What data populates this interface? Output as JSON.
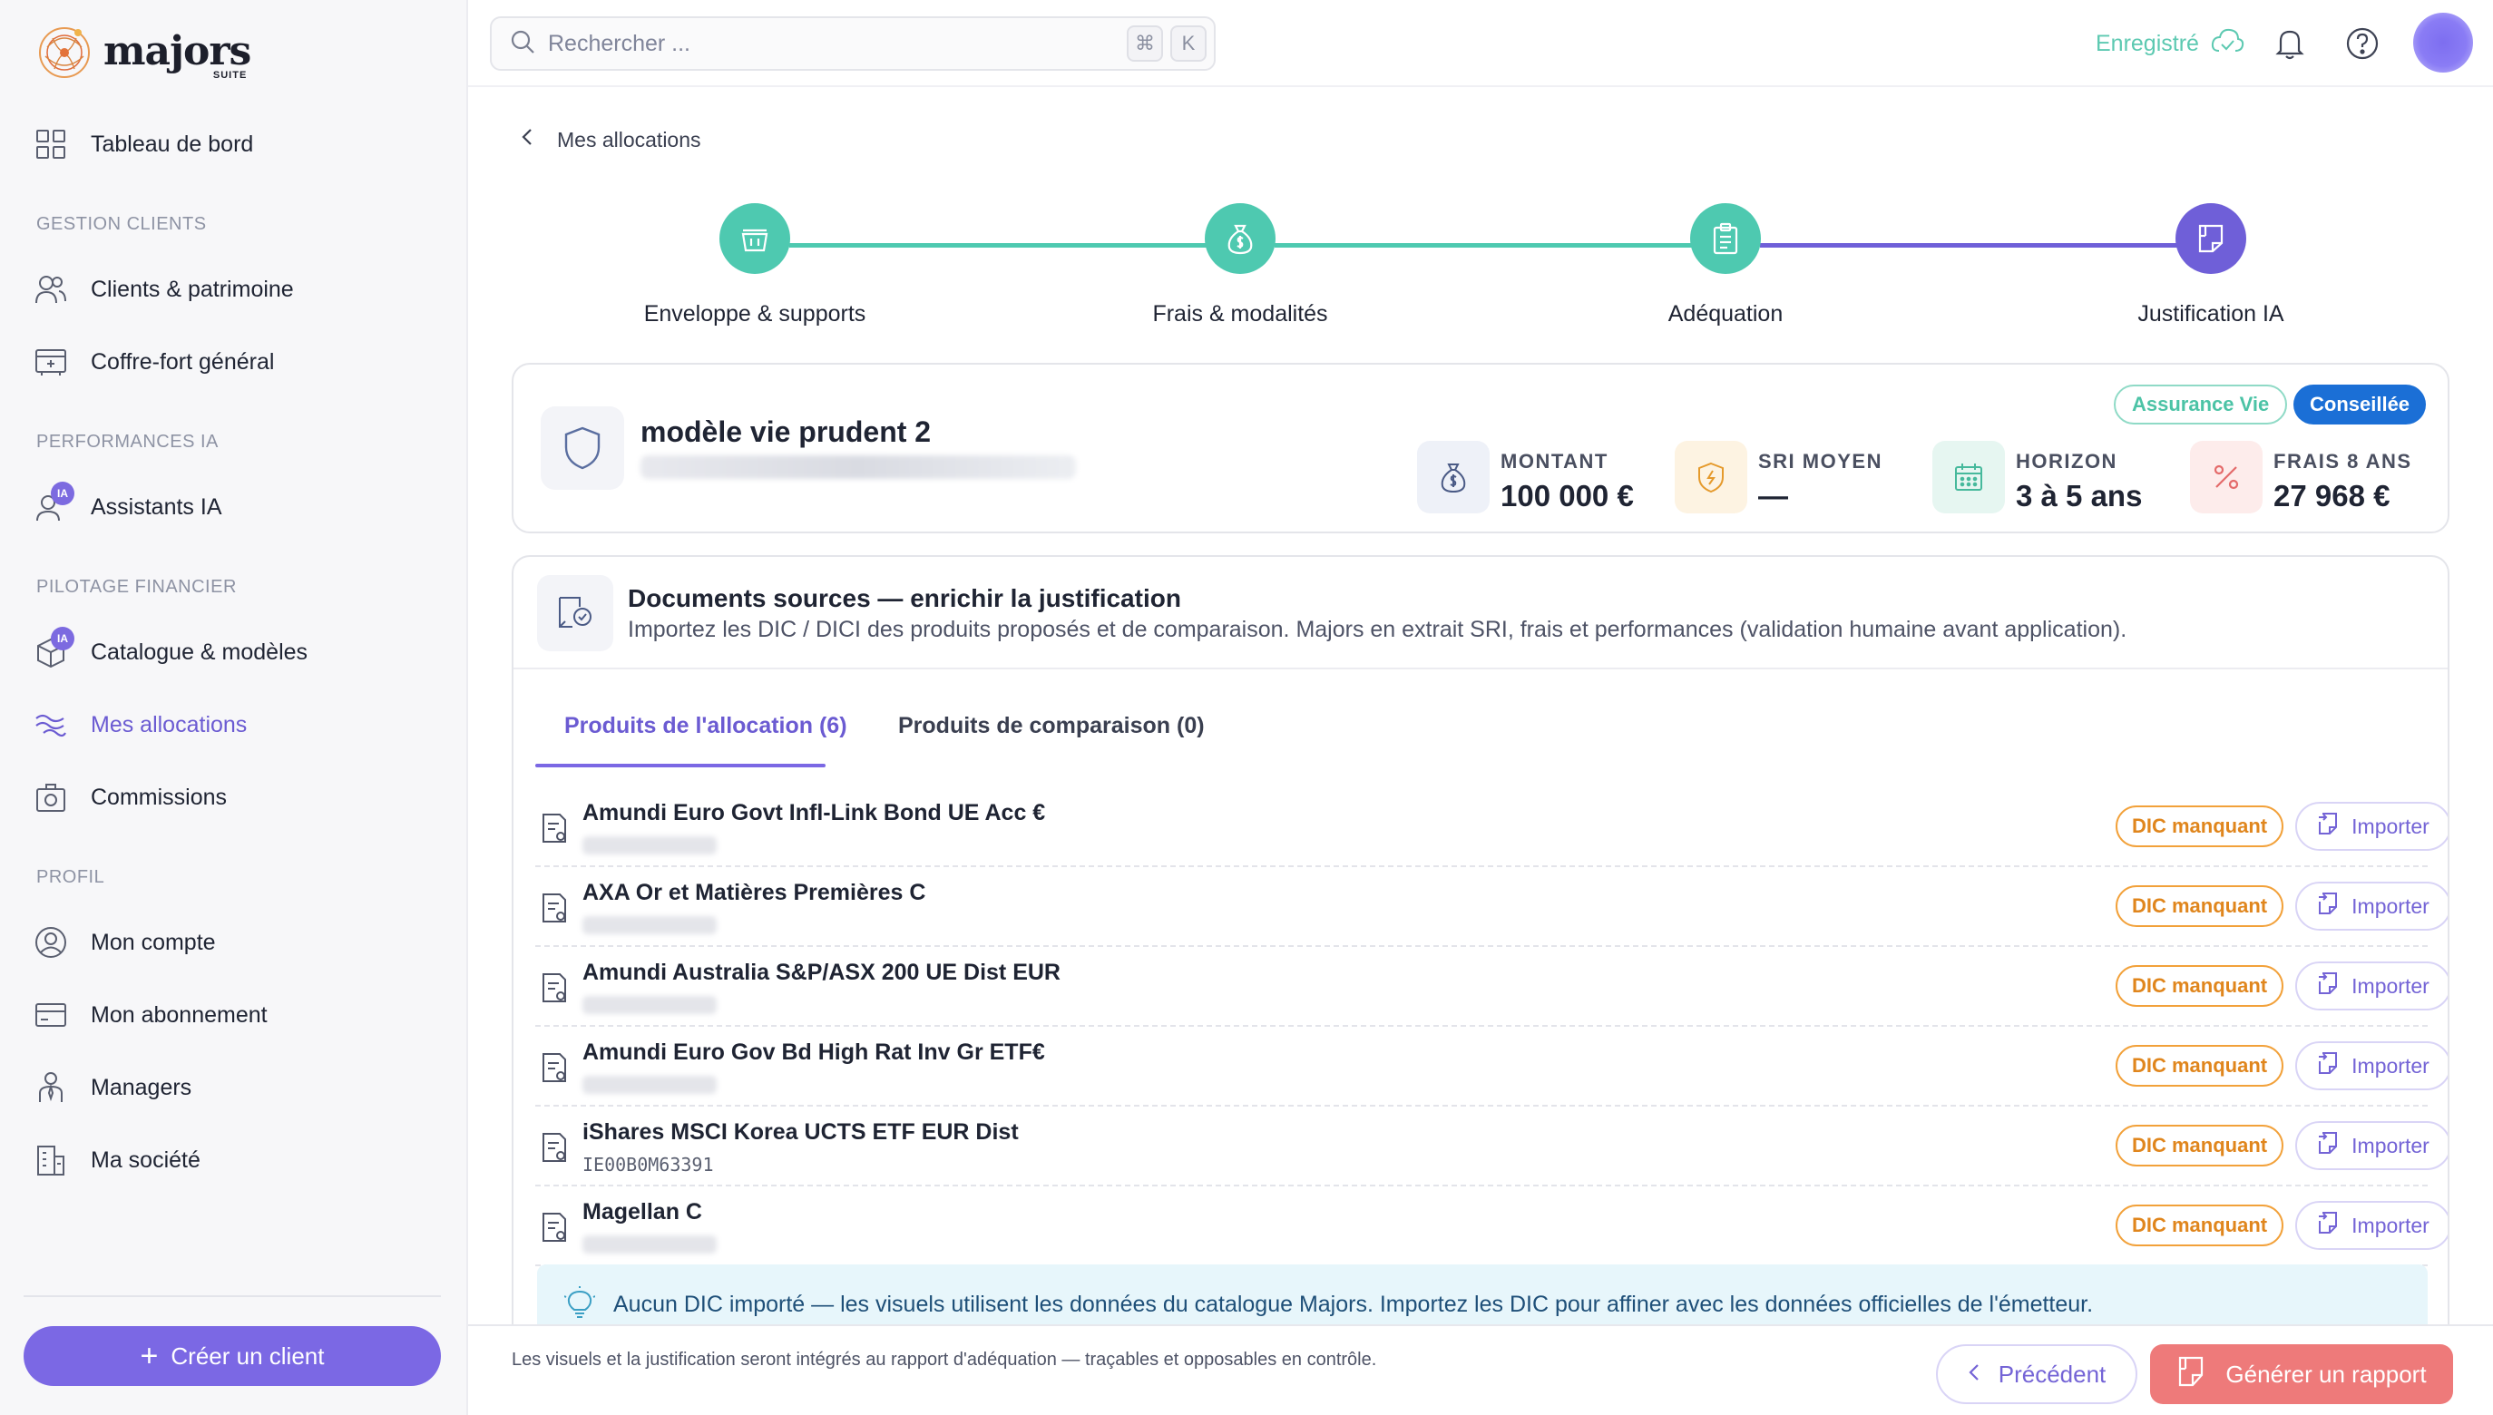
{
  "brand": {
    "name": "majors",
    "suite": "SUITE"
  },
  "sidebar": {
    "dashboard": "Tableau de bord",
    "sections": [
      {
        "title": "GESTION CLIENTS",
        "items": [
          "Clients & patrimoine",
          "Coffre-fort général"
        ]
      },
      {
        "title": "PERFORMANCES IA",
        "items": [
          "Assistants IA"
        ]
      },
      {
        "title": "PILOTAGE FINANCIER",
        "items": [
          "Catalogue & modèles",
          "Mes allocations",
          "Commissions"
        ]
      },
      {
        "title": "PROFIL",
        "items": [
          "Mon compte",
          "Mon abonnement",
          "Managers",
          "Ma société"
        ]
      }
    ],
    "ia_badge": "IA",
    "create_button": "Créer un client",
    "active_item": "Mes allocations"
  },
  "topbar": {
    "search_placeholder": "Rechercher ...",
    "shortcut_keys": [
      "⌘",
      "K"
    ],
    "saved_status": "Enregistré"
  },
  "breadcrumb": "Mes allocations",
  "stepper": {
    "steps": [
      {
        "label": "Enveloppe & supports",
        "icon": "basket-icon",
        "state": "done"
      },
      {
        "label": "Frais & modalités",
        "icon": "money-bag-icon",
        "state": "done"
      },
      {
        "label": "Adéquation",
        "icon": "clipboard-icon",
        "state": "done"
      },
      {
        "label": "Justification IA",
        "icon": "document-icon",
        "state": "current"
      }
    ],
    "colors": {
      "done": "#4ec9b0",
      "current": "#6f5fd8"
    }
  },
  "model": {
    "title": "modèle vie prudent 2",
    "tags": [
      "Assurance Vie",
      "Conseillée"
    ],
    "metrics": [
      {
        "label": "MONTANT",
        "value": "100 000 €",
        "icon": "money-bag-icon"
      },
      {
        "label": "SRI MOYEN",
        "value": "—",
        "icon": "shield-icon"
      },
      {
        "label": "HORIZON",
        "value": "3 à 5 ans",
        "icon": "calendar-icon"
      },
      {
        "label": "FRAIS 8 ANS",
        "value": "27 968 €",
        "icon": "percent-icon"
      }
    ]
  },
  "documents": {
    "title": "Documents sources — enrichir la justification",
    "description": "Importez les DIC / DICI des produits proposés et de comparaison. Majors en extrait SRI, frais et performances (validation humaine avant application).",
    "tabs": [
      "Produits de l'allocation (6)",
      "Produits de comparaison (0)"
    ],
    "active_tab": 0,
    "products": [
      {
        "name": "Amundi Euro Govt Infl-Link Bond UE Acc €",
        "isin": "",
        "status": "DIC manquant",
        "action": "Importer"
      },
      {
        "name": "AXA Or et Matières Premières C",
        "isin": "",
        "status": "DIC manquant",
        "action": "Importer"
      },
      {
        "name": "Amundi Australia S&P/ASX 200 UE Dist EUR",
        "isin": "",
        "status": "DIC manquant",
        "action": "Importer"
      },
      {
        "name": "Amundi Euro Gov Bd High Rat Inv Gr ETF€",
        "isin": "",
        "status": "DIC manquant",
        "action": "Importer"
      },
      {
        "name": "iShares MSCI Korea UCTS ETF EUR Dist",
        "isin": "IE00B0M63391",
        "status": "DIC manquant",
        "action": "Importer"
      },
      {
        "name": "Magellan C",
        "isin": "",
        "status": "DIC manquant",
        "action": "Importer"
      }
    ],
    "info_banner": "Aucun DIC importé — les visuels utilisent les données du catalogue Majors. Importez les DIC pour affiner avec les données officielles de l'émetteur."
  },
  "footer": {
    "note": "Les visuels et la justification seront intégrés au rapport d'adéquation — traçables et opposables en contrôle.",
    "prev_button": "Précédent",
    "generate_button": "Générer un rapport"
  },
  "colors": {
    "accent": "#7b68e4",
    "teal": "#4ec9b0",
    "warning": "#f2a13a",
    "danger": "#ee7a7a",
    "badge_blue": "#1b6fd6"
  }
}
